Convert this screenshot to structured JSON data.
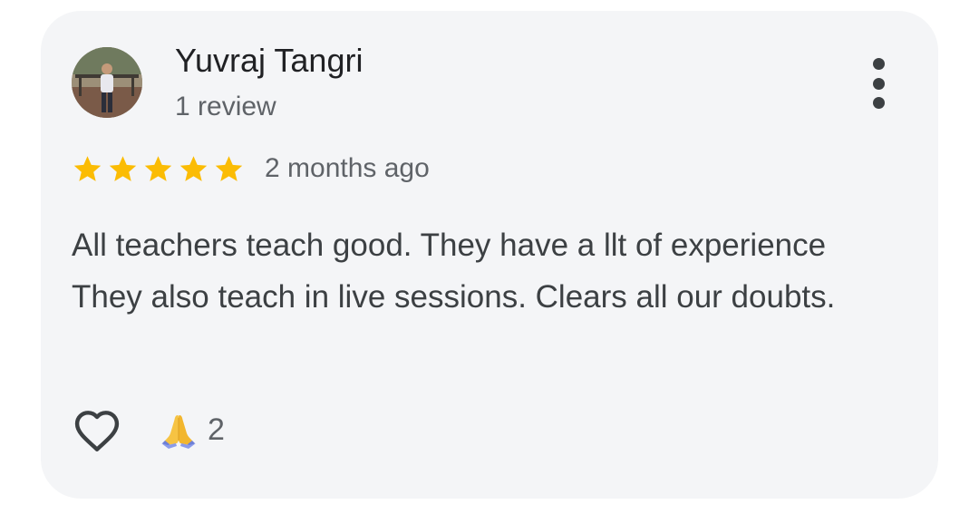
{
  "review": {
    "author_name": "Yuvraj Tangri",
    "review_count": "1 review",
    "rating": 5,
    "rating_max": 5,
    "time_ago": "2 months ago",
    "text": "All teachers teach good. They have a llt of experience They also teach in live sessions. Clears all our doubts.",
    "reaction_count": "2"
  },
  "icons": {
    "avatar": "user-photo",
    "more": "more-vert-icon",
    "star": "star-icon",
    "like": "heart-outline-icon",
    "reaction": "folded-hands-emoji"
  },
  "colors": {
    "card_background": "#f4f5f7",
    "star": "#fbbc04",
    "primary_text": "#202124",
    "secondary_text": "#5f6368"
  }
}
